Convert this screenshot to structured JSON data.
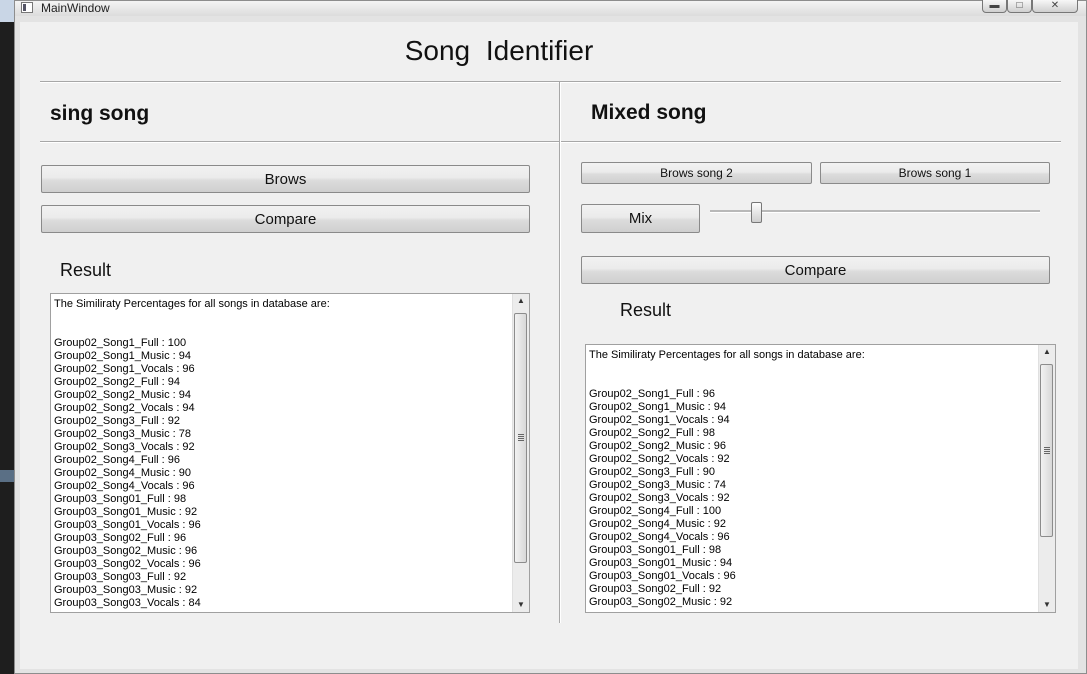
{
  "window": {
    "title": "MainWindow",
    "controls": {
      "minimize": "▬",
      "maximize": "□",
      "close": "✕"
    }
  },
  "app": {
    "title": "Song  Identifier"
  },
  "left": {
    "section_title": "sing song",
    "browse_label": "Brows",
    "compare_label": "Compare",
    "result_label": "Result",
    "result_header": "The Similiraty Percentages for all songs in database are:",
    "results": [
      "Group02_Song1_Full : 100",
      "Group02_Song1_Music : 94",
      "Group02_Song1_Vocals : 96",
      "Group02_Song2_Full : 94",
      "Group02_Song2_Music : 94",
      "Group02_Song2_Vocals : 94",
      "Group02_Song3_Full : 92",
      "Group02_Song3_Music : 78",
      "Group02_Song3_Vocals : 92",
      "Group02_Song4_Full : 96",
      "Group02_Song4_Music : 90",
      "Group02_Song4_Vocals : 96",
      "Group03_Song01_Full : 98",
      "Group03_Song01_Music : 92",
      "Group03_Song01_Vocals : 96",
      "Group03_Song02_Full : 96",
      "Group03_Song02_Music : 96",
      "Group03_Song02_Vocals : 96",
      "Group03_Song03_Full : 92",
      "Group03_Song03_Music : 92",
      "Group03_Song03_Vocals : 84"
    ]
  },
  "right": {
    "section_title": "Mixed song",
    "browse2_label": "Brows song 2",
    "browse1_label": "Brows song 1",
    "mix_label": "Mix",
    "mix_slider_value": 0.13,
    "compare_label": "Compare",
    "result_label": "Result",
    "result_header": "The Similiraty Percentages for all songs in database are:",
    "results": [
      "Group02_Song1_Full : 96",
      "Group02_Song1_Music : 94",
      "Group02_Song1_Vocals : 94",
      "Group02_Song2_Full : 98",
      "Group02_Song2_Music : 96",
      "Group02_Song2_Vocals : 92",
      "Group02_Song3_Full : 90",
      "Group02_Song3_Music : 74",
      "Group02_Song3_Vocals : 92",
      "Group02_Song4_Full : 100",
      "Group02_Song4_Music : 92",
      "Group02_Song4_Vocals : 96",
      "Group03_Song01_Full : 98",
      "Group03_Song01_Music : 94",
      "Group03_Song01_Vocals : 96",
      "Group03_Song02_Full : 92",
      "Group03_Song02_Music : 92"
    ]
  }
}
